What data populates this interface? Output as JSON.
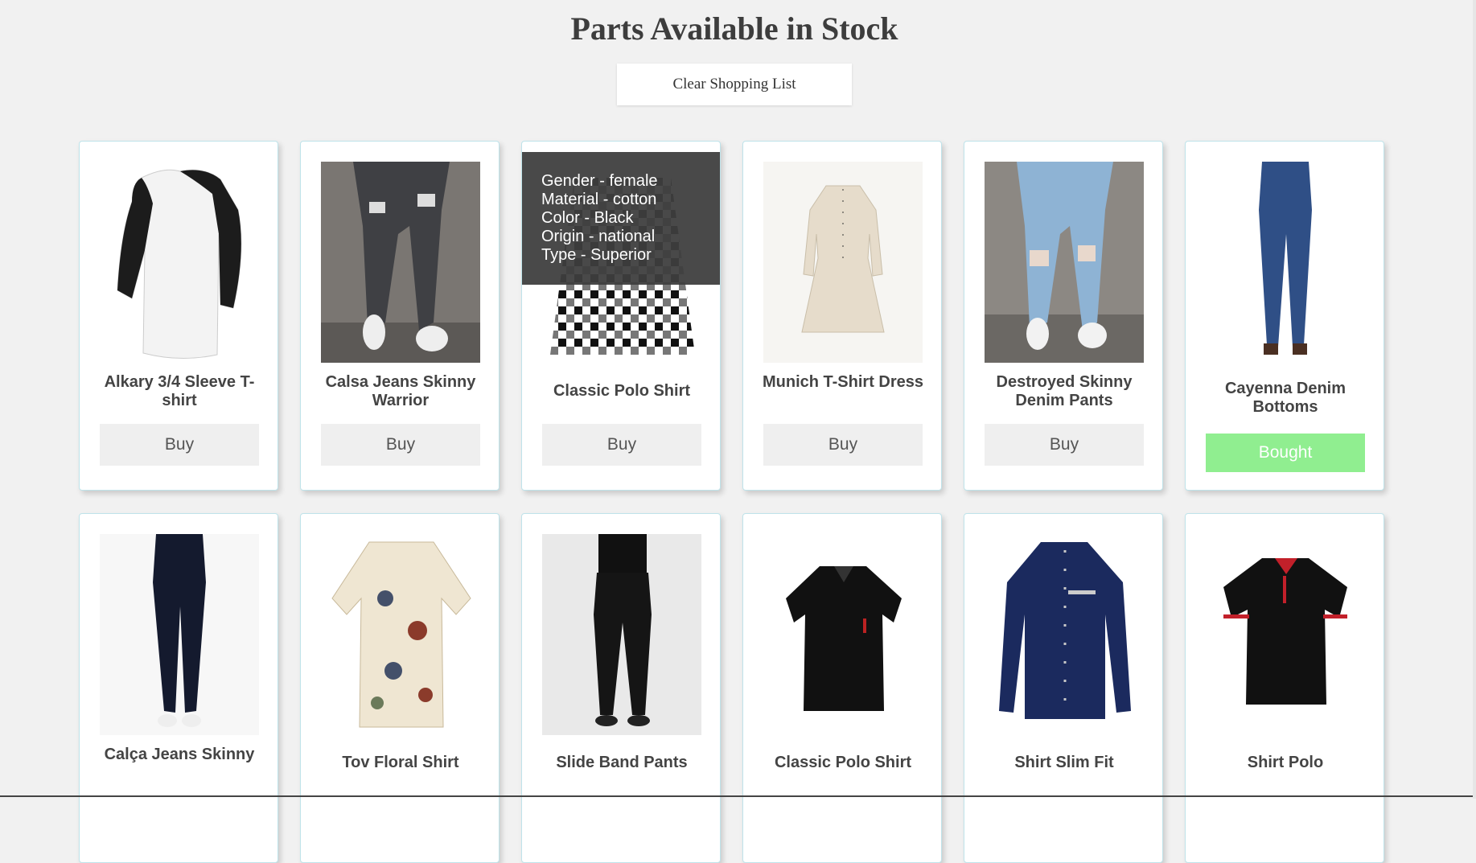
{
  "page": {
    "title": "Parts Available in Stock"
  },
  "toolbar": {
    "clear_label": "Clear Shopping List"
  },
  "products": [
    {
      "name": "Alkary 3/4 Sleeve T-shirt",
      "button": "Buy",
      "state": "buy"
    },
    {
      "name": "Calsa Jeans Skinny Warrior",
      "button": "Buy",
      "state": "buy"
    },
    {
      "name": "Classic Polo Shirt",
      "button": "Buy",
      "state": "buy",
      "details": [
        "Gender - female",
        "Material - cotton",
        "Color - Black",
        "Origin - national",
        "Type - Superior"
      ]
    },
    {
      "name": "Munich T-Shirt Dress",
      "button": "Buy",
      "state": "buy"
    },
    {
      "name": "Destroyed Skinny Denim Pants",
      "button": "Buy",
      "state": "buy"
    },
    {
      "name": "Cayenna Denim Bottoms",
      "button": "Bought",
      "state": "bought"
    },
    {
      "name": "Calça Jeans Skinny"
    },
    {
      "name": "Tov Floral Shirt"
    },
    {
      "name": "Slide Band Pants"
    },
    {
      "name": "Classic Polo Shirt"
    },
    {
      "name": "Shirt Slim Fit"
    },
    {
      "name": "Shirt Polo"
    }
  ],
  "colors": {
    "bought": "#90ee90",
    "card_border": "#bfe3ea",
    "buy_bg": "#efefef"
  }
}
